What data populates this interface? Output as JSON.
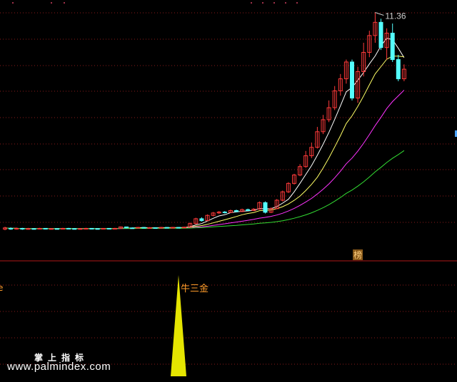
{
  "chart_data": {
    "type": "candlestick",
    "price_panel": {
      "high_label": "11.36",
      "ylim": [
        1.8,
        11.7
      ],
      "candles": [
        [
          2.35,
          2.4,
          2.3,
          2.45
        ],
        [
          2.38,
          2.36,
          2.32,
          2.42
        ],
        [
          2.36,
          2.38,
          2.33,
          2.41
        ],
        [
          2.38,
          2.35,
          2.32,
          2.4
        ],
        [
          2.35,
          2.37,
          2.33,
          2.4
        ],
        [
          2.37,
          2.36,
          2.34,
          2.39
        ],
        [
          2.36,
          2.38,
          2.34,
          2.4
        ],
        [
          2.38,
          2.36,
          2.34,
          2.39
        ],
        [
          2.36,
          2.37,
          2.35,
          2.39
        ],
        [
          2.37,
          2.36,
          2.34,
          2.38
        ],
        [
          2.36,
          2.38,
          2.35,
          2.4
        ],
        [
          2.38,
          2.37,
          2.35,
          2.4
        ],
        [
          2.37,
          2.36,
          2.35,
          2.39
        ],
        [
          2.36,
          2.37,
          2.35,
          2.38
        ],
        [
          2.37,
          2.38,
          2.36,
          2.4
        ],
        [
          2.38,
          2.37,
          2.36,
          2.39
        ],
        [
          2.37,
          2.36,
          2.35,
          2.38
        ],
        [
          2.36,
          2.38,
          2.35,
          2.39
        ],
        [
          2.38,
          2.37,
          2.36,
          2.39
        ],
        [
          2.37,
          2.38,
          2.36,
          2.4
        ],
        [
          2.38,
          2.44,
          2.37,
          2.46
        ],
        [
          2.44,
          2.4,
          2.38,
          2.45
        ],
        [
          2.4,
          2.39,
          2.37,
          2.42
        ],
        [
          2.39,
          2.42,
          2.38,
          2.44
        ],
        [
          2.42,
          2.4,
          2.39,
          2.43
        ],
        [
          2.4,
          2.41,
          2.39,
          2.43
        ],
        [
          2.41,
          2.4,
          2.39,
          2.42
        ],
        [
          2.4,
          2.42,
          2.39,
          2.44
        ],
        [
          2.42,
          2.41,
          2.4,
          2.43
        ],
        [
          2.41,
          2.42,
          2.4,
          2.44
        ],
        [
          2.42,
          2.41,
          2.4,
          2.43
        ],
        [
          2.41,
          2.43,
          2.4,
          2.45
        ],
        [
          2.43,
          2.58,
          2.42,
          2.62
        ],
        [
          2.58,
          2.78,
          2.55,
          2.82
        ],
        [
          2.78,
          2.7,
          2.66,
          2.84
        ],
        [
          2.7,
          2.92,
          2.68,
          2.96
        ],
        [
          2.92,
          3.02,
          2.88,
          3.06
        ],
        [
          3.02,
          3.06,
          2.98,
          3.1
        ],
        [
          3.06,
          3.04,
          3.0,
          3.1
        ],
        [
          3.04,
          3.12,
          3.02,
          3.16
        ],
        [
          3.12,
          3.08,
          3.05,
          3.16
        ],
        [
          3.08,
          3.16,
          3.06,
          3.2
        ],
        [
          3.16,
          3.12,
          3.1,
          3.2
        ],
        [
          3.12,
          3.18,
          3.1,
          3.22
        ],
        [
          3.18,
          3.45,
          3.16,
          3.5
        ],
        [
          3.45,
          3.05,
          3.0,
          3.5
        ],
        [
          3.05,
          3.2,
          3.02,
          3.25
        ],
        [
          3.2,
          3.55,
          3.18,
          3.6
        ],
        [
          3.55,
          3.9,
          3.5,
          3.95
        ],
        [
          3.9,
          4.25,
          3.85,
          4.3
        ],
        [
          4.25,
          4.6,
          4.2,
          4.65
        ],
        [
          4.6,
          4.95,
          4.55,
          5.05
        ],
        [
          4.95,
          5.4,
          4.9,
          5.6
        ],
        [
          5.4,
          5.75,
          5.3,
          5.95
        ],
        [
          5.75,
          6.4,
          5.7,
          6.6
        ],
        [
          6.4,
          6.9,
          6.3,
          7.1
        ],
        [
          6.9,
          7.4,
          6.8,
          7.7
        ],
        [
          7.4,
          8.1,
          7.3,
          8.3
        ],
        [
          8.1,
          8.6,
          7.9,
          8.8
        ],
        [
          8.6,
          9.3,
          8.4,
          9.4
        ],
        [
          9.3,
          7.8,
          7.7,
          9.4
        ],
        [
          7.8,
          8.9,
          7.6,
          9.1
        ],
        [
          8.9,
          9.7,
          8.7,
          10.1
        ],
        [
          9.7,
          10.4,
          9.5,
          10.6
        ],
        [
          10.4,
          10.95,
          10.1,
          11.36
        ],
        [
          10.95,
          9.9,
          9.8,
          11.1
        ],
        [
          9.9,
          10.5,
          9.4,
          10.7
        ],
        [
          10.5,
          9.4,
          9.3,
          10.9
        ],
        [
          9.4,
          8.6,
          8.5,
          9.6
        ],
        [
          8.6,
          9.0,
          8.5,
          9.2
        ]
      ],
      "moving_averages": [
        {
          "color": "#ffffff",
          "period": 5
        },
        {
          "color": "#ffff66",
          "period": 10
        },
        {
          "color": "#ff33ff",
          "period": 20
        },
        {
          "color": "#33dd33",
          "period": 40
        }
      ],
      "badge": {
        "text": "榜",
        "bar_index": 61
      }
    },
    "indicator_panel": {
      "signal_label": "牛三金",
      "spike_bar_index": 30,
      "left_marker": "e"
    }
  },
  "watermark": {
    "title": "掌上指标",
    "url": "www.palmindex.com"
  },
  "colors": {
    "up": "#ff3a3a",
    "down": "#54ffff",
    "grid": "#8a1a1a",
    "divider": "#b01818",
    "spike": "#e5e500",
    "signal_text": "#ff9c2a",
    "high_label": "#cccccc",
    "badge_bg": "#8a5a1a",
    "badge_text": "#ffd080"
  }
}
